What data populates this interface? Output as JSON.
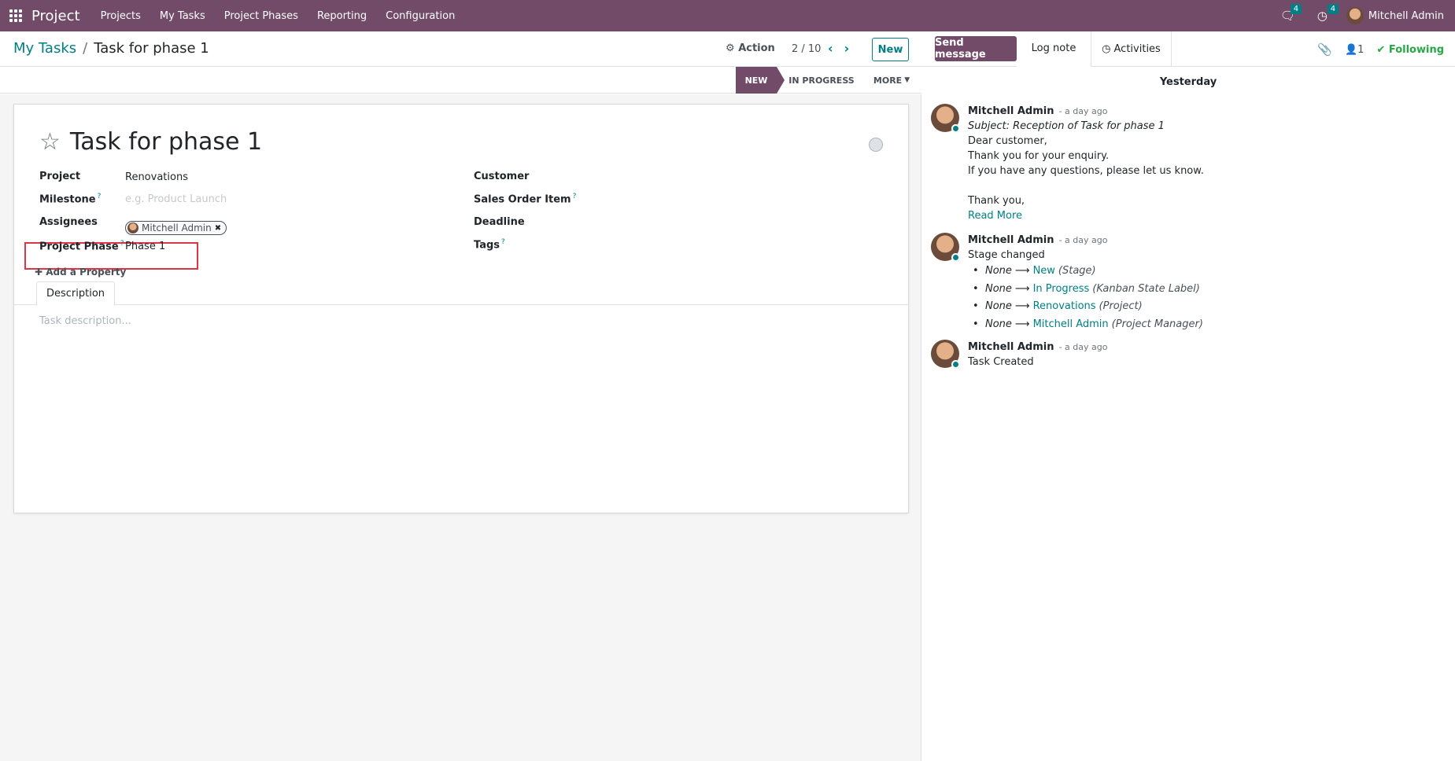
{
  "nav": {
    "app_name": "Project",
    "menu": [
      "Projects",
      "My Tasks",
      "Project Phases",
      "Reporting",
      "Configuration"
    ],
    "messages_count": "4",
    "activities_count": "4",
    "user_name": "Mitchell Admin"
  },
  "control": {
    "breadcrumb_parent": "My Tasks",
    "breadcrumb_sep": "/",
    "breadcrumb_current": "Task for phase 1",
    "action_label": "Action",
    "pager": "2 / 10",
    "new_label": "New"
  },
  "statusbar": {
    "stages": [
      "NEW",
      "IN PROGRESS"
    ],
    "active_stage": "NEW",
    "more_label": "MORE"
  },
  "form": {
    "title": "Task for phase 1",
    "left_fields": {
      "project": {
        "label": "Project",
        "value": "Renovations"
      },
      "milestone": {
        "label": "Milestone",
        "help": "?",
        "placeholder": "e.g. Product Launch"
      },
      "assignees": {
        "label": "Assignees",
        "value": "Mitchell Admin"
      },
      "project_phase": {
        "label": "Project Phase",
        "help": "?",
        "value": "Phase 1"
      }
    },
    "right_fields": {
      "customer": {
        "label": "Customer"
      },
      "sales_order_item": {
        "label": "Sales Order Item",
        "help": "?"
      },
      "deadline": {
        "label": "Deadline"
      },
      "tags": {
        "label": "Tags",
        "help": "?"
      }
    },
    "add_property": "Add a Property",
    "tab_description": "Description",
    "description_placeholder": "Task description..."
  },
  "chatter": {
    "send_message": "Send message",
    "log_note": "Log note",
    "activities": "Activities",
    "followers_count": "1",
    "following": "Following",
    "date_separator": "Yesterday",
    "messages": [
      {
        "author": "Mitchell Admin",
        "when": "- a day ago",
        "subject": "Subject: Reception of Task for phase 1",
        "lines": [
          "Dear customer,",
          "Thank you for your enquiry.",
          "If you have any questions, please let us know.",
          "",
          "Thank you,"
        ],
        "read_more": "Read More"
      },
      {
        "author": "Mitchell Admin",
        "when": "- a day ago",
        "text": "Stage changed",
        "tracking": [
          {
            "old": "None",
            "new": "New",
            "field": "(Stage)"
          },
          {
            "old": "None",
            "new": "In Progress",
            "field": "(Kanban State Label)"
          },
          {
            "old": "None",
            "new": "Renovations",
            "field": "(Project)"
          },
          {
            "old": "None",
            "new": "Mitchell Admin",
            "field": "(Project Manager)"
          }
        ]
      },
      {
        "author": "Mitchell Admin",
        "when": "- a day ago",
        "text": "Task Created"
      }
    ]
  },
  "colors": {
    "brand": "#714b67",
    "accent": "#017e84",
    "following": "#28a745",
    "highlight": "#dc3545"
  }
}
